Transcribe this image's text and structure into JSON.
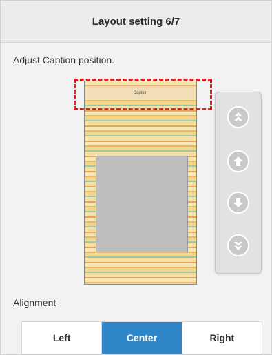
{
  "header": {
    "title": "Layout setting 6/7"
  },
  "instruction": "Adjust Caption position.",
  "preview": {
    "caption_text": "Caption"
  },
  "arrows": [
    {
      "icon": "double-up-icon"
    },
    {
      "icon": "up-icon"
    },
    {
      "icon": "down-icon"
    },
    {
      "icon": "double-down-icon"
    }
  ],
  "alignment": {
    "label": "Alignment",
    "options": [
      "Left",
      "Center",
      "Right"
    ],
    "selected": "Center"
  },
  "colors": {
    "accent": "#2f86c9",
    "highlight": "#e31c1c"
  }
}
